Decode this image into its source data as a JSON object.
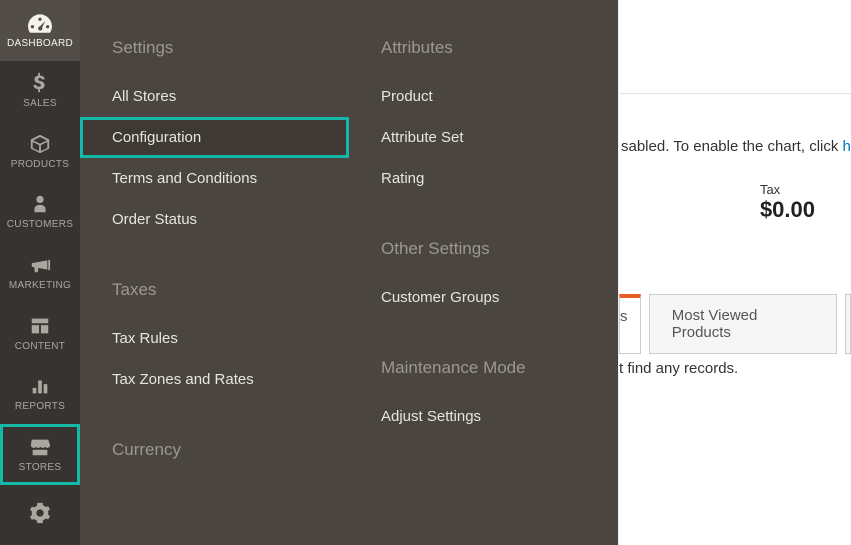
{
  "rail": {
    "items": [
      {
        "label": "DASHBOARD"
      },
      {
        "label": "SALES"
      },
      {
        "label": "PRODUCTS"
      },
      {
        "label": "CUSTOMERS"
      },
      {
        "label": "MARKETING"
      },
      {
        "label": "CONTENT"
      },
      {
        "label": "REPORTS"
      },
      {
        "label": "STORES"
      },
      {
        "label": ""
      }
    ]
  },
  "flyout": {
    "col1": {
      "groups": [
        {
          "heading": "Settings",
          "items": [
            "All Stores",
            "Configuration",
            "Terms and Conditions",
            "Order Status"
          ]
        },
        {
          "heading": "Taxes",
          "items": [
            "Tax Rules",
            "Tax Zones and Rates"
          ]
        },
        {
          "heading": "Currency",
          "items": []
        }
      ]
    },
    "col2": {
      "groups": [
        {
          "heading": "Attributes",
          "items": [
            "Product",
            "Attribute Set",
            "Rating"
          ]
        },
        {
          "heading": "Other Settings",
          "items": [
            "Customer Groups"
          ]
        },
        {
          "heading": "Maintenance Mode",
          "items": [
            "Adjust Settings"
          ]
        }
      ]
    }
  },
  "main": {
    "chart_msg_a": "sabled. To enable the chart, click ",
    "chart_msg_link": "her",
    "tax": {
      "label": "Tax",
      "value": "$0.00"
    },
    "tabs": {
      "partial": "s",
      "tab1": "Most Viewed Products"
    },
    "no_records": "t find any records."
  }
}
